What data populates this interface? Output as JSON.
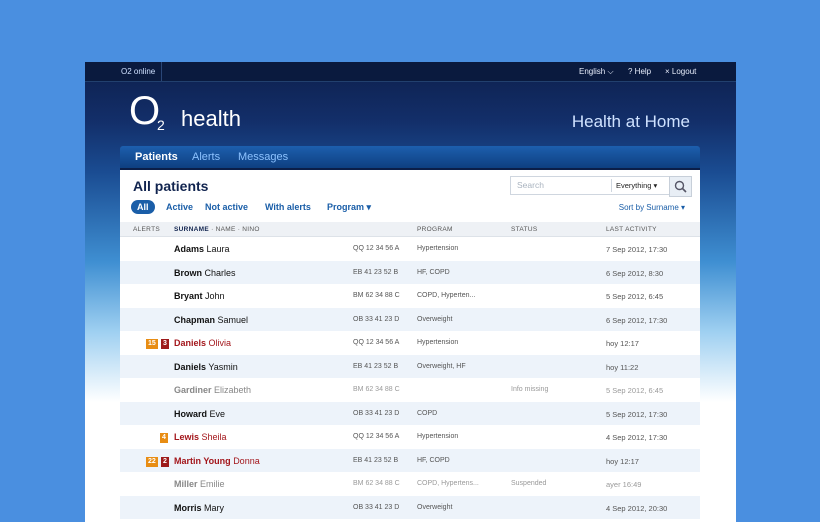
{
  "topbar": {
    "brand": "O2 online",
    "language": "English ⌵",
    "help": "? Help",
    "logout": "× Logout"
  },
  "header": {
    "logo_o": "O",
    "logo_two": "2",
    "logo_word": "health",
    "tagline": "Health at Home"
  },
  "nav": {
    "patients": "Patients",
    "alerts": "Alerts",
    "messages": "Messages"
  },
  "page": {
    "title": "All patients"
  },
  "search": {
    "placeholder": "Search",
    "scope": "Everything ▾"
  },
  "filters": {
    "all": "All",
    "active": "Active",
    "not_active": "Not active",
    "with_alerts": "With alerts",
    "program": "Program ▾"
  },
  "sort": {
    "label": "Sort by Surname ▾"
  },
  "table": {
    "headers": {
      "alerts": "ALERTS",
      "surname": "SURNAME",
      "name_nino": " · NAME · NINO",
      "program": "PROGRAM",
      "status": "STATUS",
      "last_activity": "LAST ACTIVITY"
    },
    "rows": [
      {
        "surname": "Adams",
        "first": "Laura",
        "nino": "QQ 12 34 56 A",
        "program": "Hypertension",
        "status": "",
        "last": "7 Sep 2012, 17:30"
      },
      {
        "surname": "Brown",
        "first": "Charles",
        "nino": "EB 41 23 52 B",
        "program": "HF, COPD",
        "status": "",
        "last": "6 Sep 2012, 8:30"
      },
      {
        "surname": "Bryant",
        "first": "John",
        "nino": "BM 62 34 88 C",
        "program": "COPD, Hyperten...",
        "status": "",
        "last": "5 Sep 2012, 6:45"
      },
      {
        "surname": "Chapman",
        "first": "Samuel",
        "nino": "OB 33 41 23 D",
        "program": "Overweight",
        "status": "",
        "last": "6 Sep 2012, 17:30"
      },
      {
        "surname": "Daniels",
        "first": "Olivia",
        "nino": "QQ 12 34 56 A",
        "program": "Hypertension",
        "status": "",
        "last": "hoy 12:17",
        "alerts": [
          "15",
          "3"
        ]
      },
      {
        "surname": "Daniels",
        "first": "Yasmin",
        "nino": "EB 41 23 52 B",
        "program": "Overweight, HF",
        "status": "",
        "last": "hoy 11:22"
      },
      {
        "surname": "Gardiner",
        "first": "Elizabeth",
        "nino": "BM 62 34 88 C",
        "program": "",
        "status": "Info missing",
        "last": "5 Sep 2012, 6:45"
      },
      {
        "surname": "Howard",
        "first": "Eve",
        "nino": "OB 33 41 23 D",
        "program": "COPD",
        "status": "",
        "last": "5 Sep 2012, 17:30"
      },
      {
        "surname": "Lewis",
        "first": "Sheila",
        "nino": "QQ 12 34 56 A",
        "program": "Hypertension",
        "status": "",
        "last": "4 Sep 2012, 17:30",
        "alerts": [
          "4"
        ]
      },
      {
        "surname": "Martin Young",
        "first": "Donna",
        "nino": "EB 41 23 52 B",
        "program": "HF, COPD",
        "status": "",
        "last": "hoy 12:17",
        "alerts": [
          "22",
          "2"
        ]
      },
      {
        "surname": "Miller",
        "first": "Emilie",
        "nino": "BM 62 34 88 C",
        "program": "COPD, Hypertens...",
        "status": "Suspended",
        "last": "ayer 16:49"
      },
      {
        "surname": "Morris",
        "first": "Mary",
        "nino": "OB 33 41 23 D",
        "program": "Overweight",
        "status": "",
        "last": "4 Sep 2012, 20:30"
      }
    ]
  },
  "colors": {
    "background": "#4a8fe0",
    "alert_orange": "#e88d14",
    "alert_red": "#9d1a1a",
    "link_blue": "#1a5ea8"
  }
}
